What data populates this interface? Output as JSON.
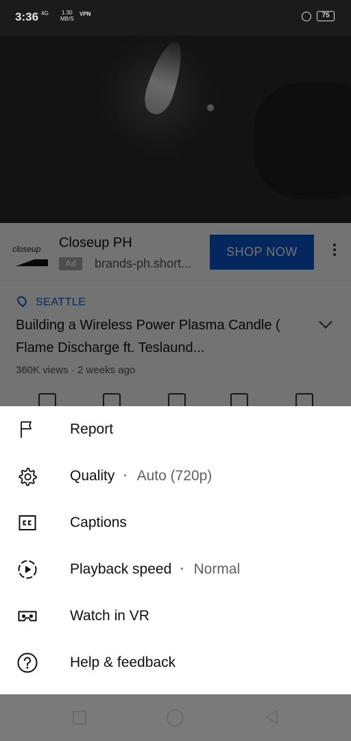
{
  "status_bar": {
    "time": "3:36",
    "network": "4G",
    "speed_value": "1.30",
    "speed_unit": "MB/S",
    "vpn": "VPN",
    "battery": "75"
  },
  "ad": {
    "logo_text": "closeup",
    "title": "Closeup PH",
    "badge": "Ad",
    "domain": "brands-ph.short...",
    "cta": "SHOP NOW"
  },
  "video": {
    "location": "SEATTLE",
    "title": "Building a Wireless Power Plasma Candle ( Flame Discharge ft. Teslaund...",
    "meta": "360K views · 2 weeks ago"
  },
  "menu": {
    "report": {
      "label": "Report",
      "icon": "flag-icon"
    },
    "quality": {
      "label": "Quality",
      "dot": "•",
      "value": "Auto (720p)",
      "icon": "gear-icon"
    },
    "captions": {
      "label": "Captions",
      "icon": "cc-icon"
    },
    "playback_speed": {
      "label": "Playback speed",
      "dot": "•",
      "value": "Normal",
      "icon": "playback-speed-icon"
    },
    "watch_vr": {
      "label": "Watch in VR",
      "icon": "vr-headset-icon"
    },
    "help": {
      "label": "Help & feedback",
      "icon": "help-icon"
    }
  },
  "colors": {
    "accent_blue": "#0b57d0",
    "sheet_bg": "#ffffff",
    "text_primary": "#0f0f0f",
    "text_secondary": "#606060"
  }
}
